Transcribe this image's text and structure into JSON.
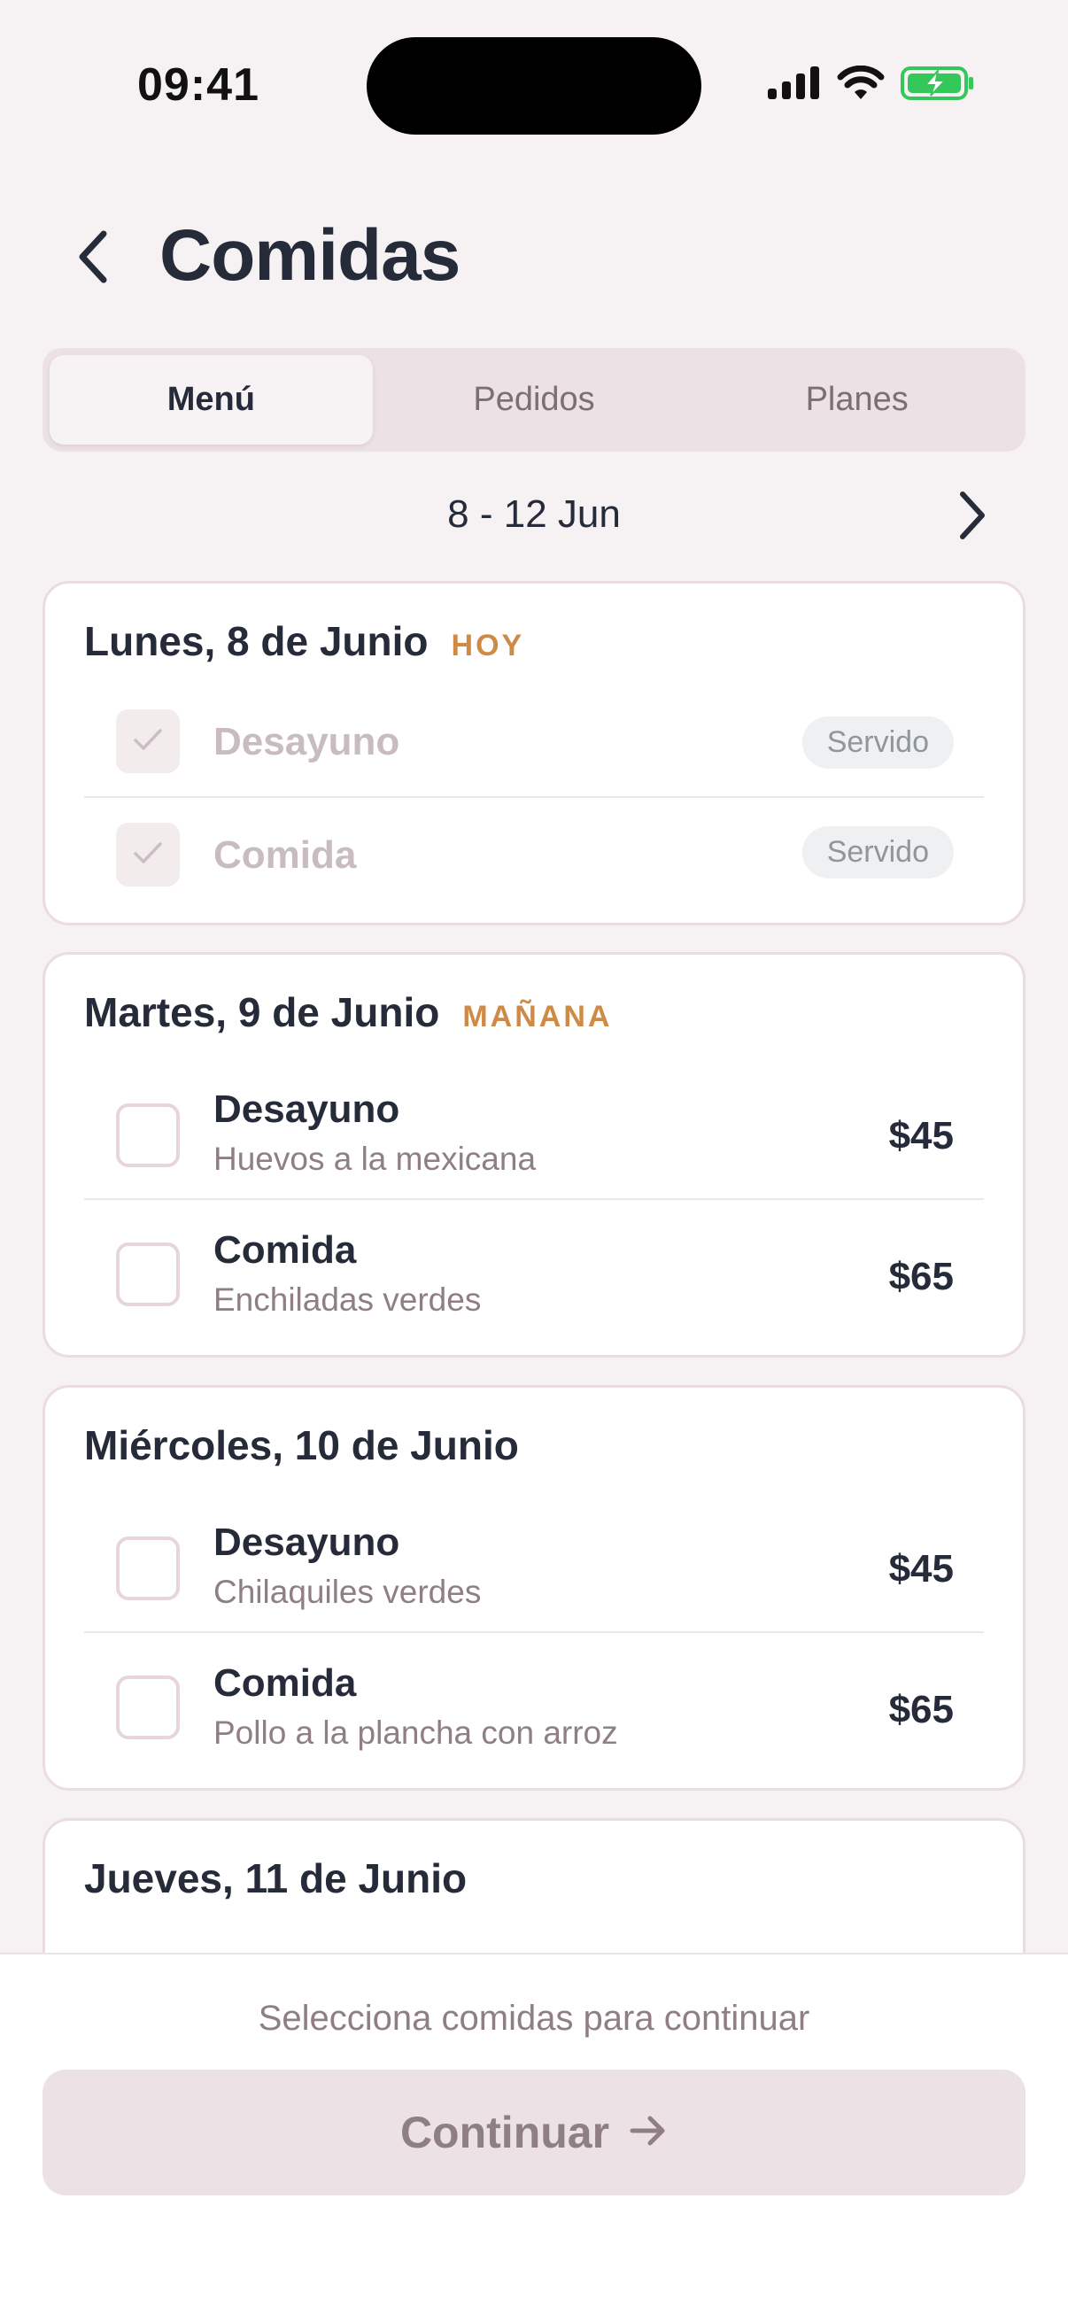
{
  "status_bar": {
    "time": "09:41",
    "icons": [
      "cellular-signal-icon",
      "wifi-icon",
      "battery-charging-icon"
    ]
  },
  "header": {
    "back_icon": "chevron-left-icon",
    "title": "Comidas"
  },
  "tabs": [
    {
      "label": "Menú",
      "active": true
    },
    {
      "label": "Pedidos",
      "active": false
    },
    {
      "label": "Planes",
      "active": false
    }
  ],
  "week": {
    "label": "8 - 12 Jun",
    "next_icon": "chevron-right-icon"
  },
  "days": [
    {
      "title": "Lunes, 8 de Junio",
      "badge": "HOY",
      "meals": [
        {
          "name": "Desayuno",
          "dish": "",
          "status": "Servido",
          "checked": true
        },
        {
          "name": "Comida",
          "dish": "",
          "status": "Servido",
          "checked": true
        }
      ]
    },
    {
      "title": "Martes, 9 de Junio",
      "badge": "MAÑANA",
      "meals": [
        {
          "name": "Desayuno",
          "dish": "Huevos a la mexicana",
          "price": "$45",
          "checked": false
        },
        {
          "name": "Comida",
          "dish": "Enchiladas verdes",
          "price": "$65",
          "checked": false
        }
      ]
    },
    {
      "title": "Miércoles, 10 de Junio",
      "badge": "",
      "meals": [
        {
          "name": "Desayuno",
          "dish": "Chilaquiles verdes",
          "price": "$45",
          "checked": false
        },
        {
          "name": "Comida",
          "dish": "Pollo a la plancha con arroz",
          "price": "$65",
          "checked": false
        }
      ]
    },
    {
      "title": "Jueves, 11 de Junio",
      "badge": ""
    }
  ],
  "footer": {
    "hint": "Selecciona comidas para continuar",
    "continue_label": "Continuar",
    "continue_icon": "arrow-right-icon"
  },
  "colors": {
    "background": "#f6f2f3",
    "text": "#262b3a",
    "accent_badge": "#cf8a45",
    "muted": "#8f7f85",
    "segment_bg": "#ece1e4"
  }
}
